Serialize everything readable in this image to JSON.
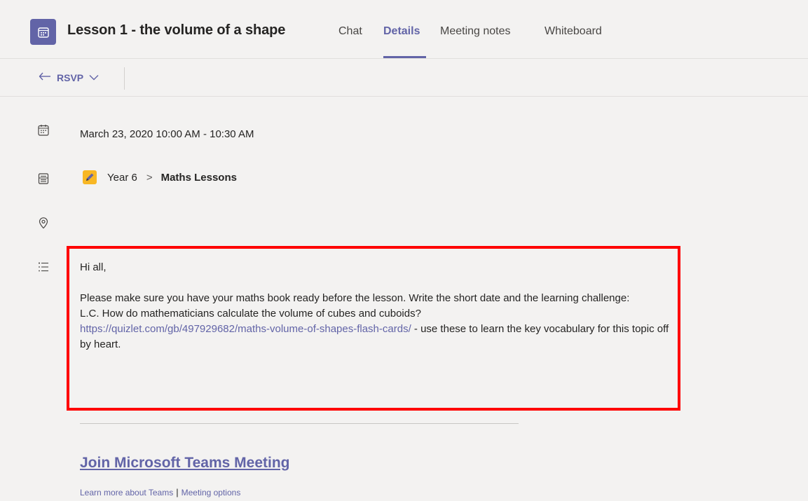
{
  "header": {
    "title": "Lesson 1 - the volume of a shape",
    "app_icon": "calendar-icon",
    "tabs": [
      {
        "label": "Chat",
        "active": false
      },
      {
        "label": "Details",
        "active": true
      },
      {
        "label": "Meeting notes",
        "active": false
      },
      {
        "label": "Whiteboard",
        "active": false
      }
    ]
  },
  "toolbar": {
    "rsvp_label": "RSVP",
    "rsvp_icon": "reply-arrow-icon",
    "rsvp_dropdown_icon": "chevron-down-icon"
  },
  "details": {
    "datetime": "March 23, 2020 10:00 AM - 10:30 AM",
    "team": "Year 6",
    "breadcrumb_separator": ">",
    "channel": "Maths Lessons",
    "location": ""
  },
  "description": {
    "greeting": "Hi all,",
    "line1": "Please make sure you have your maths book ready before the lesson. Write the short date and the learning challenge:",
    "line2": "L.C. How do mathematicians calculate the volume of cubes and cuboids?",
    "link": "https://quizlet.com/gb/497929682/maths-volume-of-shapes-flash-cards/",
    "after_link": " - use these to learn the key vocabulary for this topic off by heart."
  },
  "meeting": {
    "join_label": "Join Microsoft Teams Meeting",
    "learn_more": "Learn more about Teams",
    "separator": "|",
    "options": "Meeting options"
  },
  "colors": {
    "accent": "#6264a7",
    "background": "#f3f2f1",
    "highlight_border": "#ff0000",
    "team_badge": "#f8b724"
  }
}
